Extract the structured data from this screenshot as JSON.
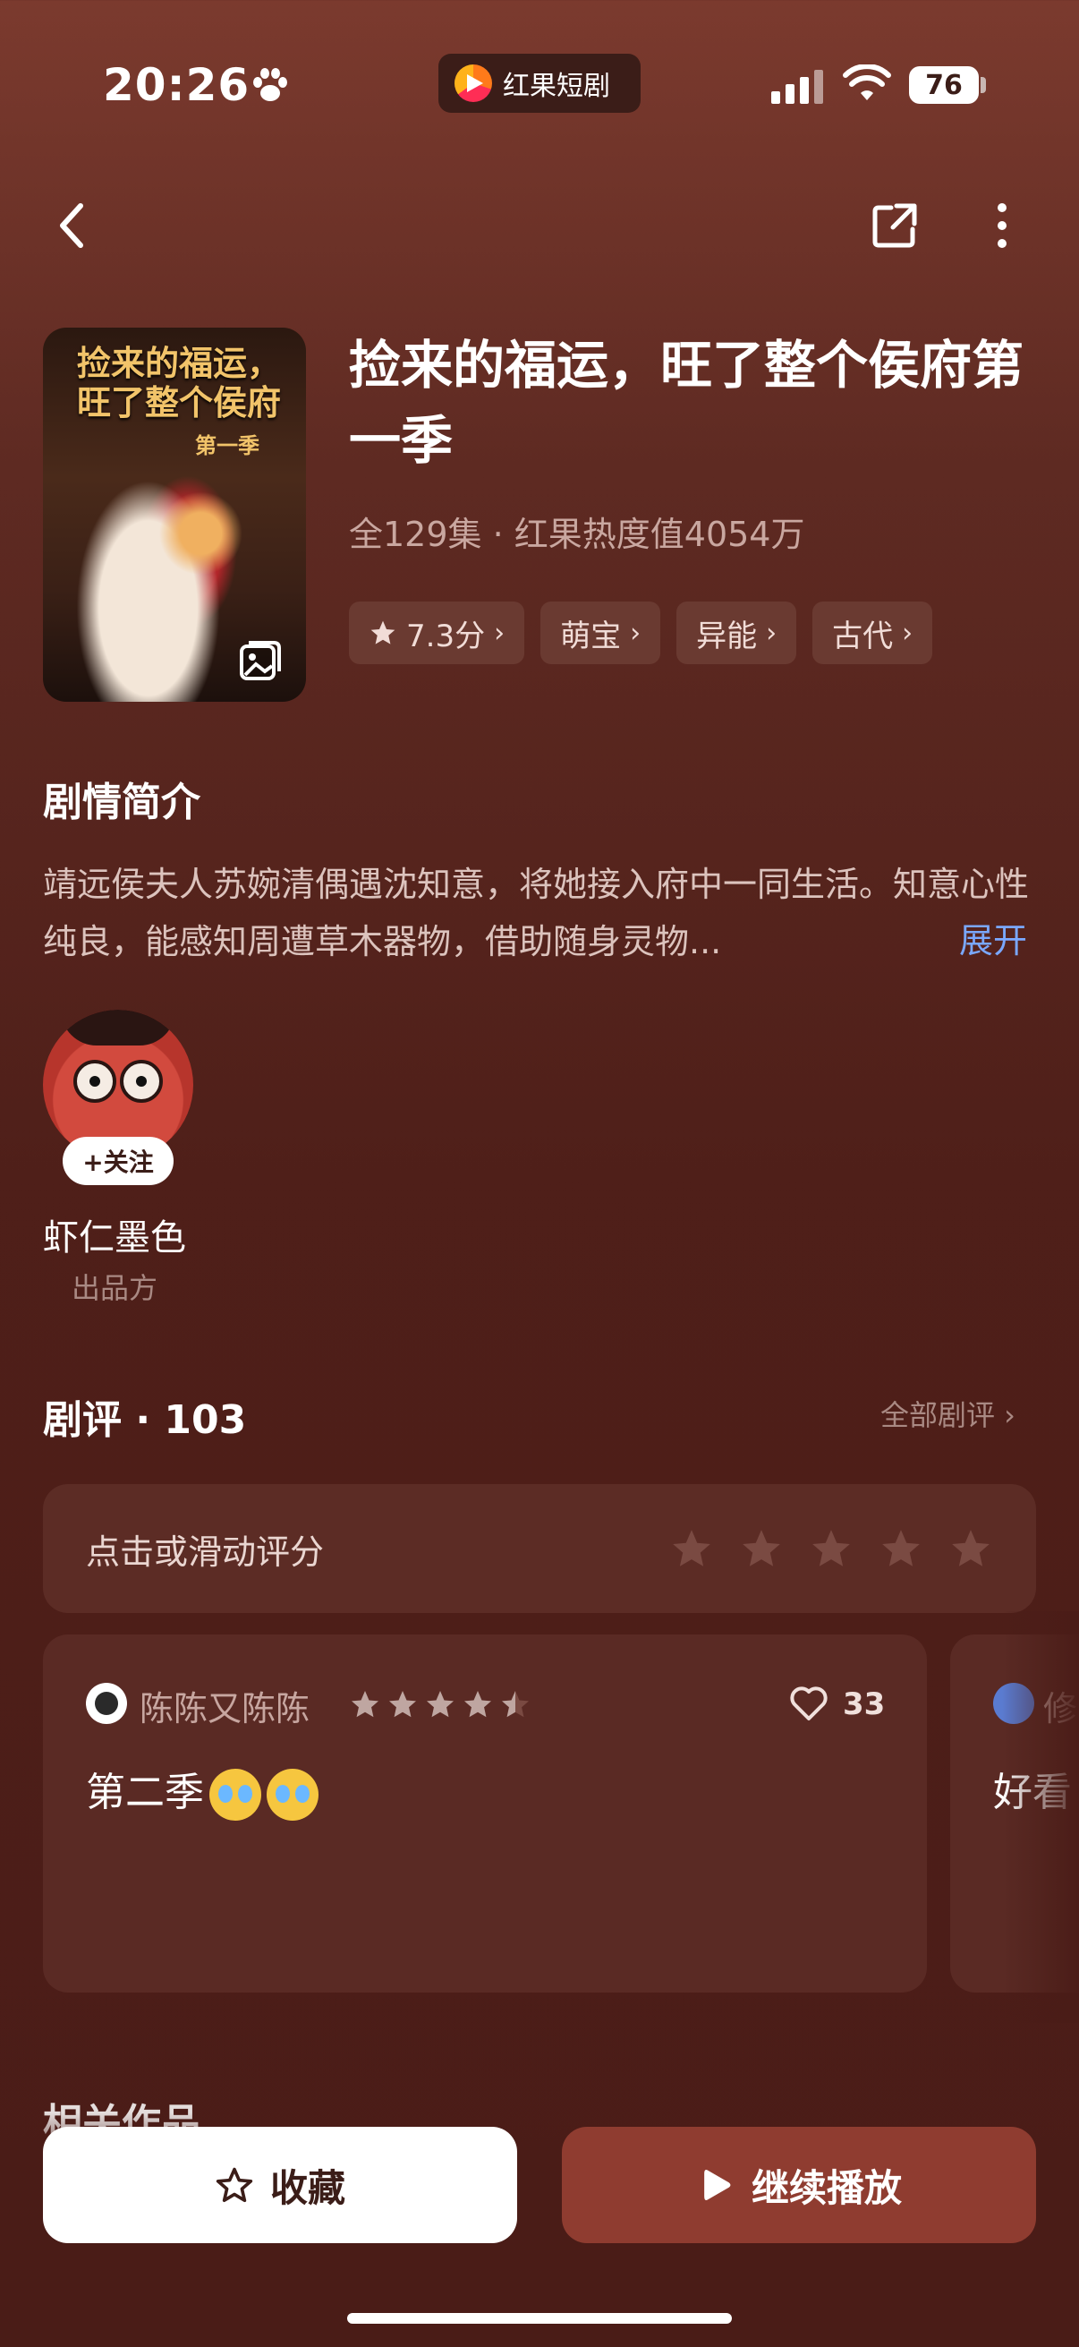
{
  "status_bar": {
    "time": "20:26",
    "app_name": "红果短剧",
    "battery": "76"
  },
  "drama": {
    "cover_title": "捡来的福运，旺了整个侯府",
    "cover_season": "第一季",
    "title": "捡来的福运，旺了整个侯府第一季",
    "meta": "全129集 · 红果热度值4054万",
    "tags": [
      "7.3分",
      "萌宝",
      "异能",
      "古代"
    ]
  },
  "synopsis": {
    "heading": "剧情简介",
    "text": "靖远侯夫人苏婉清偶遇沈知意，将她接入府中一同生活。知意心性纯良，能感知周遭草木器物，借助随身灵物...",
    "expand": "展开"
  },
  "producer": {
    "follow": "+关注",
    "name": "虾仁墨色",
    "role": "出品方"
  },
  "reviews": {
    "heading": "剧评 · 103",
    "all": "全部剧评 ›",
    "rate_prompt": "点击或滑动评分",
    "items": [
      {
        "user": "陈陈又陈陈",
        "rating": 4.5,
        "likes": "33",
        "text": "第二季"
      },
      {
        "user": "修",
        "text": "好看"
      }
    ]
  },
  "related_heading": "相关作品",
  "actions": {
    "favorite": "收藏",
    "play": "继续播放"
  },
  "colors": {
    "accent_play": "#8f3c30",
    "expand_link": "#7aa8ff",
    "background": "#4f1f19"
  }
}
